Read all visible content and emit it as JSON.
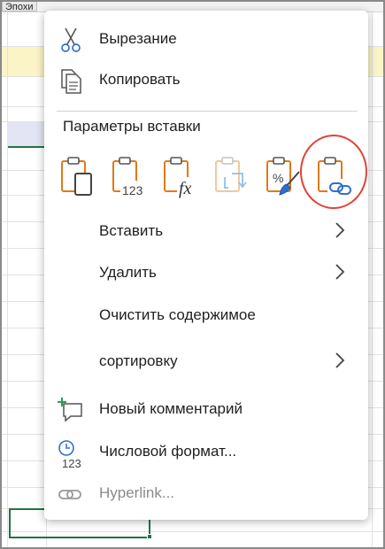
{
  "sheet": {
    "tag": "Эпохи"
  },
  "menu": {
    "cut": {
      "label": "Вырезание",
      "icon": "scissors-icon"
    },
    "copy": {
      "label": "Копировать",
      "icon": "copy-icon"
    },
    "paste_options": {
      "label": "Параметры вставки",
      "buttons": [
        {
          "icon": "paste-icon"
        },
        {
          "icon": "paste-values-icon",
          "text": "123"
        },
        {
          "icon": "paste-formulas-icon",
          "text": "fx"
        },
        {
          "icon": "paste-transpose-icon",
          "disabled": true
        },
        {
          "icon": "paste-formatting-icon",
          "text": "%"
        },
        {
          "icon": "paste-link-icon",
          "highlighted": true
        }
      ]
    },
    "insert": {
      "label": "Вставить"
    },
    "delete": {
      "label": "Удалить"
    },
    "clear": {
      "label": "Очистить содержимое"
    },
    "sort": {
      "label": "сортировку"
    },
    "new_comment": {
      "label": "Новый комментарий",
      "icon": "new-comment-icon"
    },
    "number_format": {
      "label": "Числовой формат...",
      "icon": "number-format-icon",
      "icon_text": "123"
    },
    "hyperlink": {
      "label": "Hyperlink...",
      "icon": "link-icon",
      "disabled": true
    }
  },
  "colors": {
    "accent_orange": "#e07a16",
    "icon_gray": "#555555",
    "highlight_red": "#e2433a",
    "excel_green": "#217346",
    "comment_green": "#2e9e4f",
    "light_blue": "#7fb6e6"
  }
}
